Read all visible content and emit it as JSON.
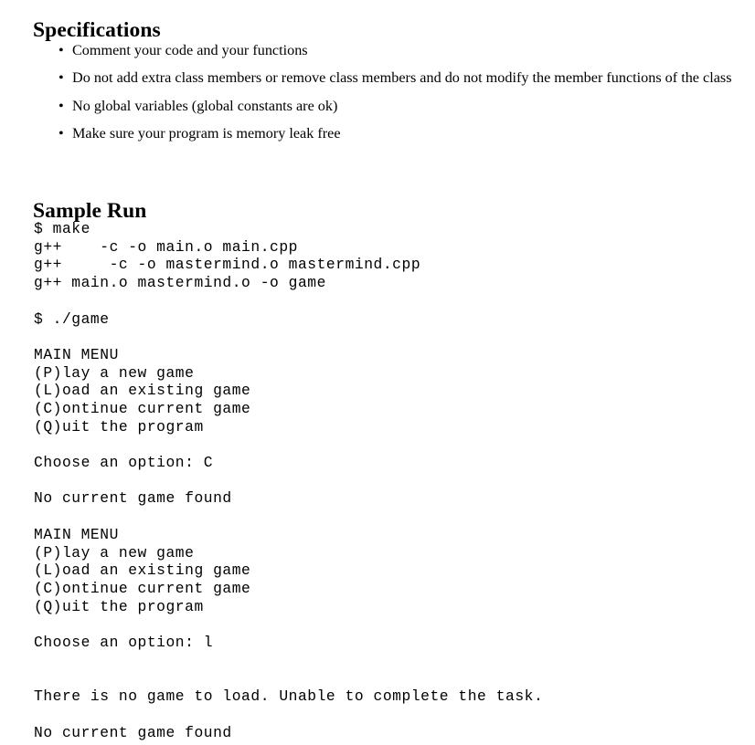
{
  "document": {
    "sections": [
      {
        "heading": "Specifications",
        "bullet_glyph": "•",
        "items": [
          "Comment your code and your functions",
          "Do not add extra class members or remove class members and do not modify the member functions of the class",
          "No global variables (global constants are ok)",
          "Make sure your program is memory leak free"
        ]
      },
      {
        "heading": "Sample Run"
      }
    ],
    "sample_run": {
      "lines": [
        "$ make",
        "g++    -c -o main.o main.cpp",
        "g++     -c -o mastermind.o mastermind.cpp",
        "g++ main.o mastermind.o -o game",
        "",
        "$ ./game",
        "",
        "MAIN MENU",
        "(P)lay a new game",
        "(L)oad an existing game",
        "(C)ontinue current game",
        "(Q)uit the program",
        "",
        "Choose an option: C",
        "",
        "No current game found",
        "",
        "MAIN MENU",
        "(P)lay a new game",
        "(L)oad an existing game",
        "(C)ontinue current game",
        "(Q)uit the program",
        "",
        "Choose an option: l",
        "",
        "",
        "There is no game to load. Unable to complete the task.",
        "",
        "No current game found"
      ]
    },
    "colors": {
      "page_background": "#ffffff",
      "text": "#000000"
    }
  }
}
